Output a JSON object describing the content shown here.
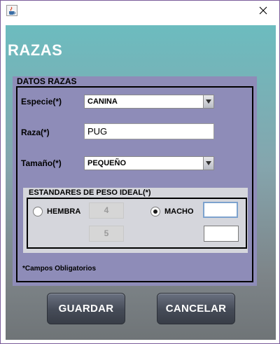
{
  "window": {
    "close_glyph": "✕",
    "app_icon": "java-cup-icon"
  },
  "form": {
    "heading": "RAZAS",
    "panel_title": "DATOS RAZAS",
    "especie": {
      "label": "Especie(*)",
      "value": "CANINA"
    },
    "raza": {
      "label": "Raza(*)",
      "value": "PUG"
    },
    "tamano": {
      "label": "Tamaño(*)",
      "value": "PEQUEÑO"
    },
    "weights": {
      "title": "ESTANDARES DE PESO IDEAL(*)",
      "hembra": {
        "label": "HEMBRA",
        "selected": false,
        "min": "4",
        "max": "5"
      },
      "macho": {
        "label": "MACHO",
        "selected": true,
        "min": "",
        "max": ""
      }
    },
    "required_note": "*Campos Obligatorios"
  },
  "buttons": {
    "save": "GUARDAR",
    "cancel": "CANCELAR"
  },
  "colors": {
    "content_top": "#6cbcbf",
    "content_bottom": "#6f7477",
    "panel": "#8e8cb8",
    "button": "#454b57"
  }
}
